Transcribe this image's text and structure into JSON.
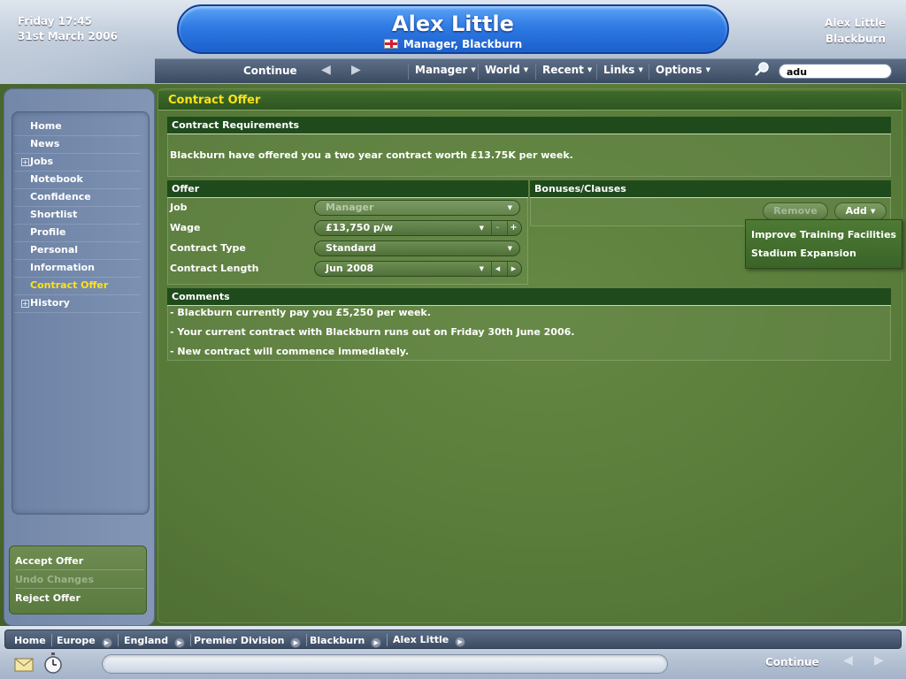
{
  "header": {
    "date_line1": "Friday 17:45",
    "date_line2": "31st March 2006",
    "title": "Alex Little",
    "subtitle": "Manager, Blackburn",
    "user_name": "Alex Little",
    "user_club": "Blackburn"
  },
  "nav": {
    "continue_label": "Continue",
    "menus": [
      "Manager",
      "World",
      "Recent",
      "Links",
      "Options"
    ],
    "search_value": "adu"
  },
  "sidebar": {
    "items": [
      {
        "label": "Home"
      },
      {
        "label": "News"
      },
      {
        "label": "Jobs",
        "expandable": true
      },
      {
        "label": "Notebook"
      },
      {
        "label": "Confidence"
      },
      {
        "label": "Shortlist"
      },
      {
        "label": "Profile"
      },
      {
        "label": "Personal"
      },
      {
        "label": "Information"
      },
      {
        "label": "Contract Offer",
        "active": true
      },
      {
        "label": "History",
        "expandable": true
      }
    ],
    "actions": [
      {
        "label": "Accept Offer"
      },
      {
        "label": "Undo Changes",
        "disabled": true
      },
      {
        "label": "Reject Offer"
      }
    ]
  },
  "main": {
    "title": "Contract Offer",
    "requirements": {
      "header": "Contract Requirements",
      "text": "Blackburn have offered you a two year contract worth £13.75K per week."
    },
    "offer": {
      "header": "Offer",
      "fields": [
        {
          "label": "Job",
          "value": "Manager"
        },
        {
          "label": "Wage",
          "value": "£13,750 p/w"
        },
        {
          "label": "Contract Type",
          "value": "Standard"
        },
        {
          "label": "Contract Length",
          "value": "Jun 2008"
        }
      ]
    },
    "bonuses": {
      "header": "Bonuses/Clauses",
      "remove_label": "Remove",
      "add_label": "Add",
      "popup_items": [
        "Improve Training Facilities",
        "Stadium Expansion"
      ]
    },
    "comments": {
      "header": "Comments",
      "lines": [
        "- Blackburn currently pay you £5,250 per week.",
        "- Your current contract with Blackburn runs out on Friday 30th June 2006.",
        "- New contract will commence immediately."
      ]
    }
  },
  "footer": {
    "breadcrumbs": [
      "Home",
      "Europe",
      "England",
      "Premier Division",
      "Blackburn",
      "Alex Little"
    ],
    "continue_label": "Continue"
  }
}
